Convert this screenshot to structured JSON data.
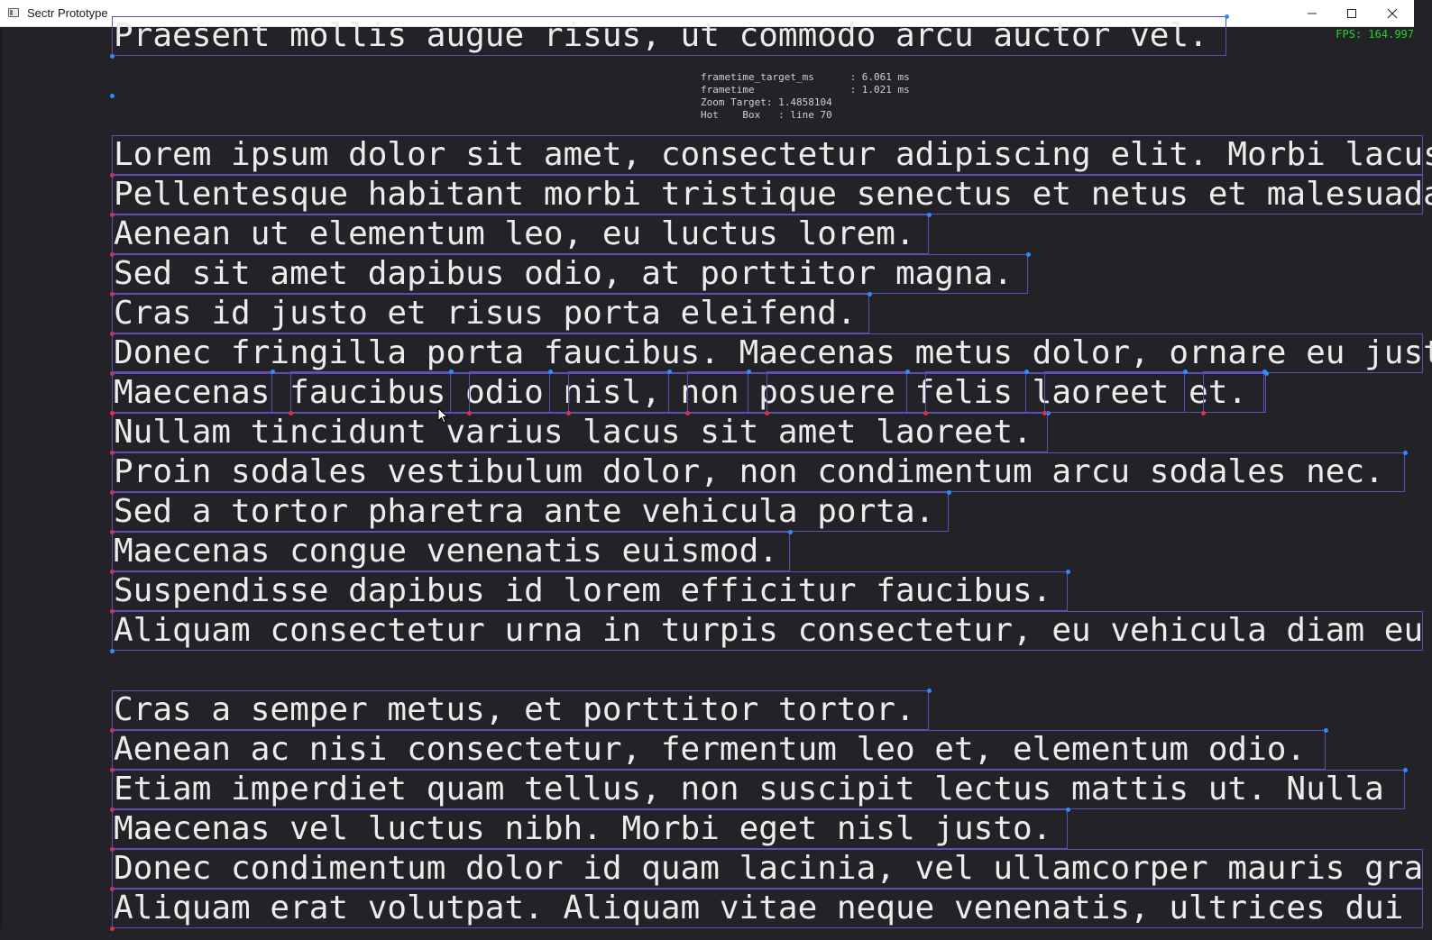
{
  "window": {
    "title": "Sectr Prototype",
    "controls": [
      "minimize-icon",
      "maximize-icon",
      "close-icon"
    ]
  },
  "overlay": {
    "fps": "FPS: 164.997",
    "stats": [
      "frametime_target_ms      : 6.061 ms",
      "frametime                : 1.021 ms",
      "Zoom Target: 1.4858104",
      "Hot    Box   : line 70"
    ]
  },
  "top_line": "Praesent mollis augue risus, ut commodo arcu auctor vel.",
  "paragraph1": [
    "Lorem ipsum dolor sit amet, consectetur adipiscing elit. Morbi lacus",
    "Pellentesque habitant morbi tristique senectus et netus et malesuada",
    "Aenean ut elementum leo, eu luctus lorem.",
    "Sed sit amet dapibus odio, at porttitor magna.",
    "Cras id justo et risus porta eleifend.",
    "Donec fringilla porta faucibus. Maecenas metus dolor, ornare eu justo",
    "Maecenas faucibus odio nisl, non posuere felis laoreet et.",
    "Nullam tincidunt varius lacus sit amet laoreet.",
    "Proin sodales vestibulum dolor, non condimentum arcu sodales nec.",
    "Sed a tortor pharetra ante vehicula porta.",
    "Maecenas congue venenatis euismod.",
    "Suspendisse dapibus id lorem efficitur faucibus.",
    "Aliquam consectetur urna in turpis consectetur, eu vehicula diam eu"
  ],
  "paragraph2": [
    "Cras a semper metus, et porttitor tortor.",
    "Aenean ac nisi consectetur, fermentum leo et, elementum odio.",
    "Etiam imperdiet quam tellus, non suscipit lectus mattis ut. Nulla",
    "Maecenas vel luctus nibh. Morbi eget nisl justo.",
    "Donec condimentum dolor id quam lacinia, vel ullamcorper mauris gra",
    "Aliquam erat volutpat. Aliquam vitae neque venenatis, ultrices dui"
  ],
  "colors": {
    "background": "#232327",
    "box_outline": "#5d4fb4",
    "text": "#ececec",
    "fps": "#27d227",
    "dot_blue": "#2f8bff",
    "dot_red": "#e0304a"
  }
}
